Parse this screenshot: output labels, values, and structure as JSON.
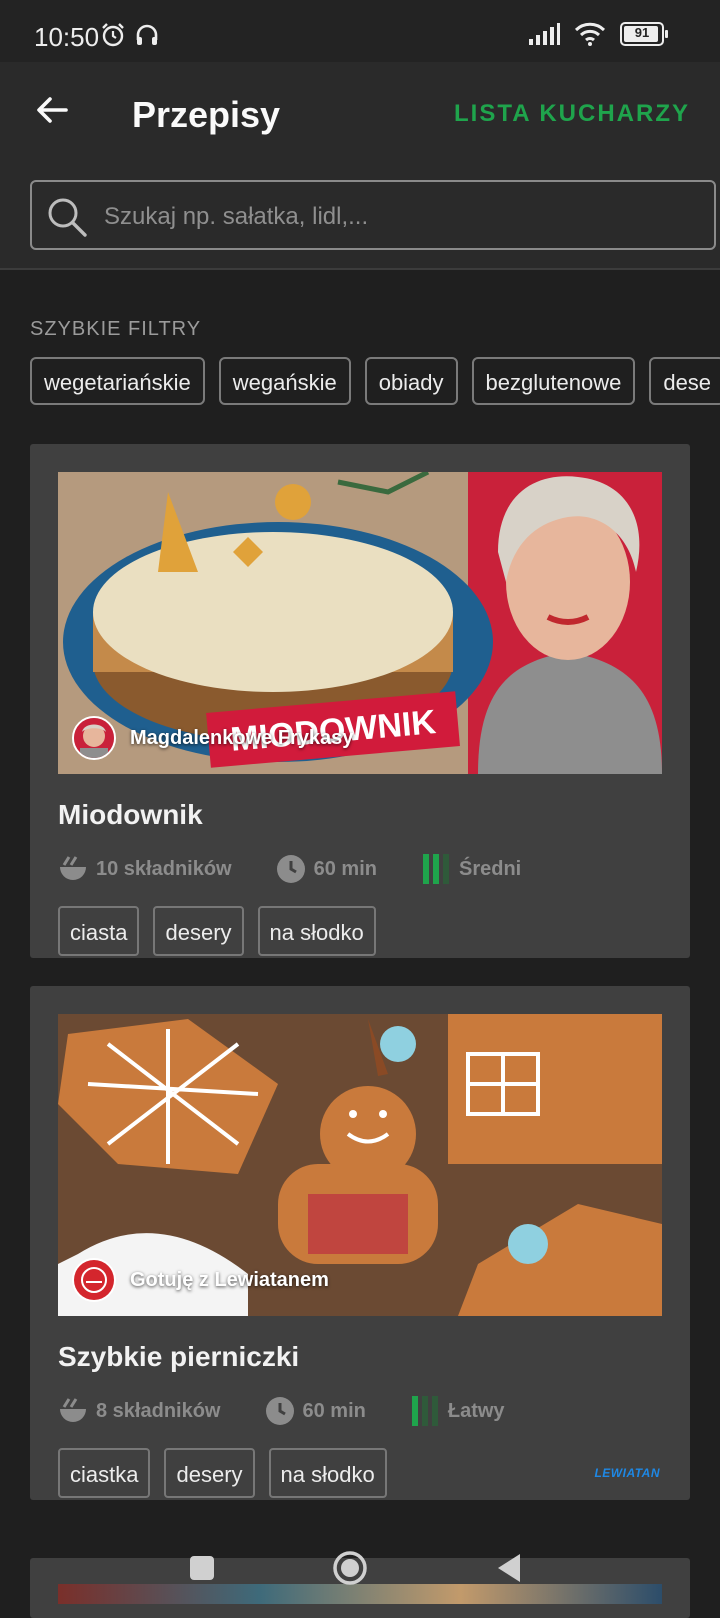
{
  "status_bar": {
    "time": "10:50",
    "battery": "91"
  },
  "app_bar": {
    "title": "Przepisy",
    "cooks_link": "LISTA KUCHARZY"
  },
  "search": {
    "placeholder": "Szukaj np. sałatka, lidl,..."
  },
  "quick_filters": {
    "label": "SZYBKIE FILTRY",
    "chips": [
      "wegetariańskie",
      "wegańskie",
      "obiady",
      "bezglutenowe",
      "dese"
    ]
  },
  "recipes": [
    {
      "author": "Magdalenkowe Frykasy",
      "image_caption": "MIODOWNIK",
      "title": "Miodownik",
      "ingredients": "10 składników",
      "time": "60 min",
      "difficulty": "Średni",
      "tags": [
        "ciasta",
        "desery",
        "na słodko"
      ]
    },
    {
      "author": "Gotuję z Lewiatanem",
      "title": "Szybkie pierniczki",
      "ingredients": "8 składników",
      "time": "60 min",
      "difficulty": "Łatwy",
      "tags": [
        "ciastka",
        "desery",
        "na słodko"
      ],
      "sponsor": "LEWIATAN"
    }
  ],
  "colors": {
    "accent": "#1fa44c",
    "background": "#1f1f1f",
    "card": "#404040"
  }
}
